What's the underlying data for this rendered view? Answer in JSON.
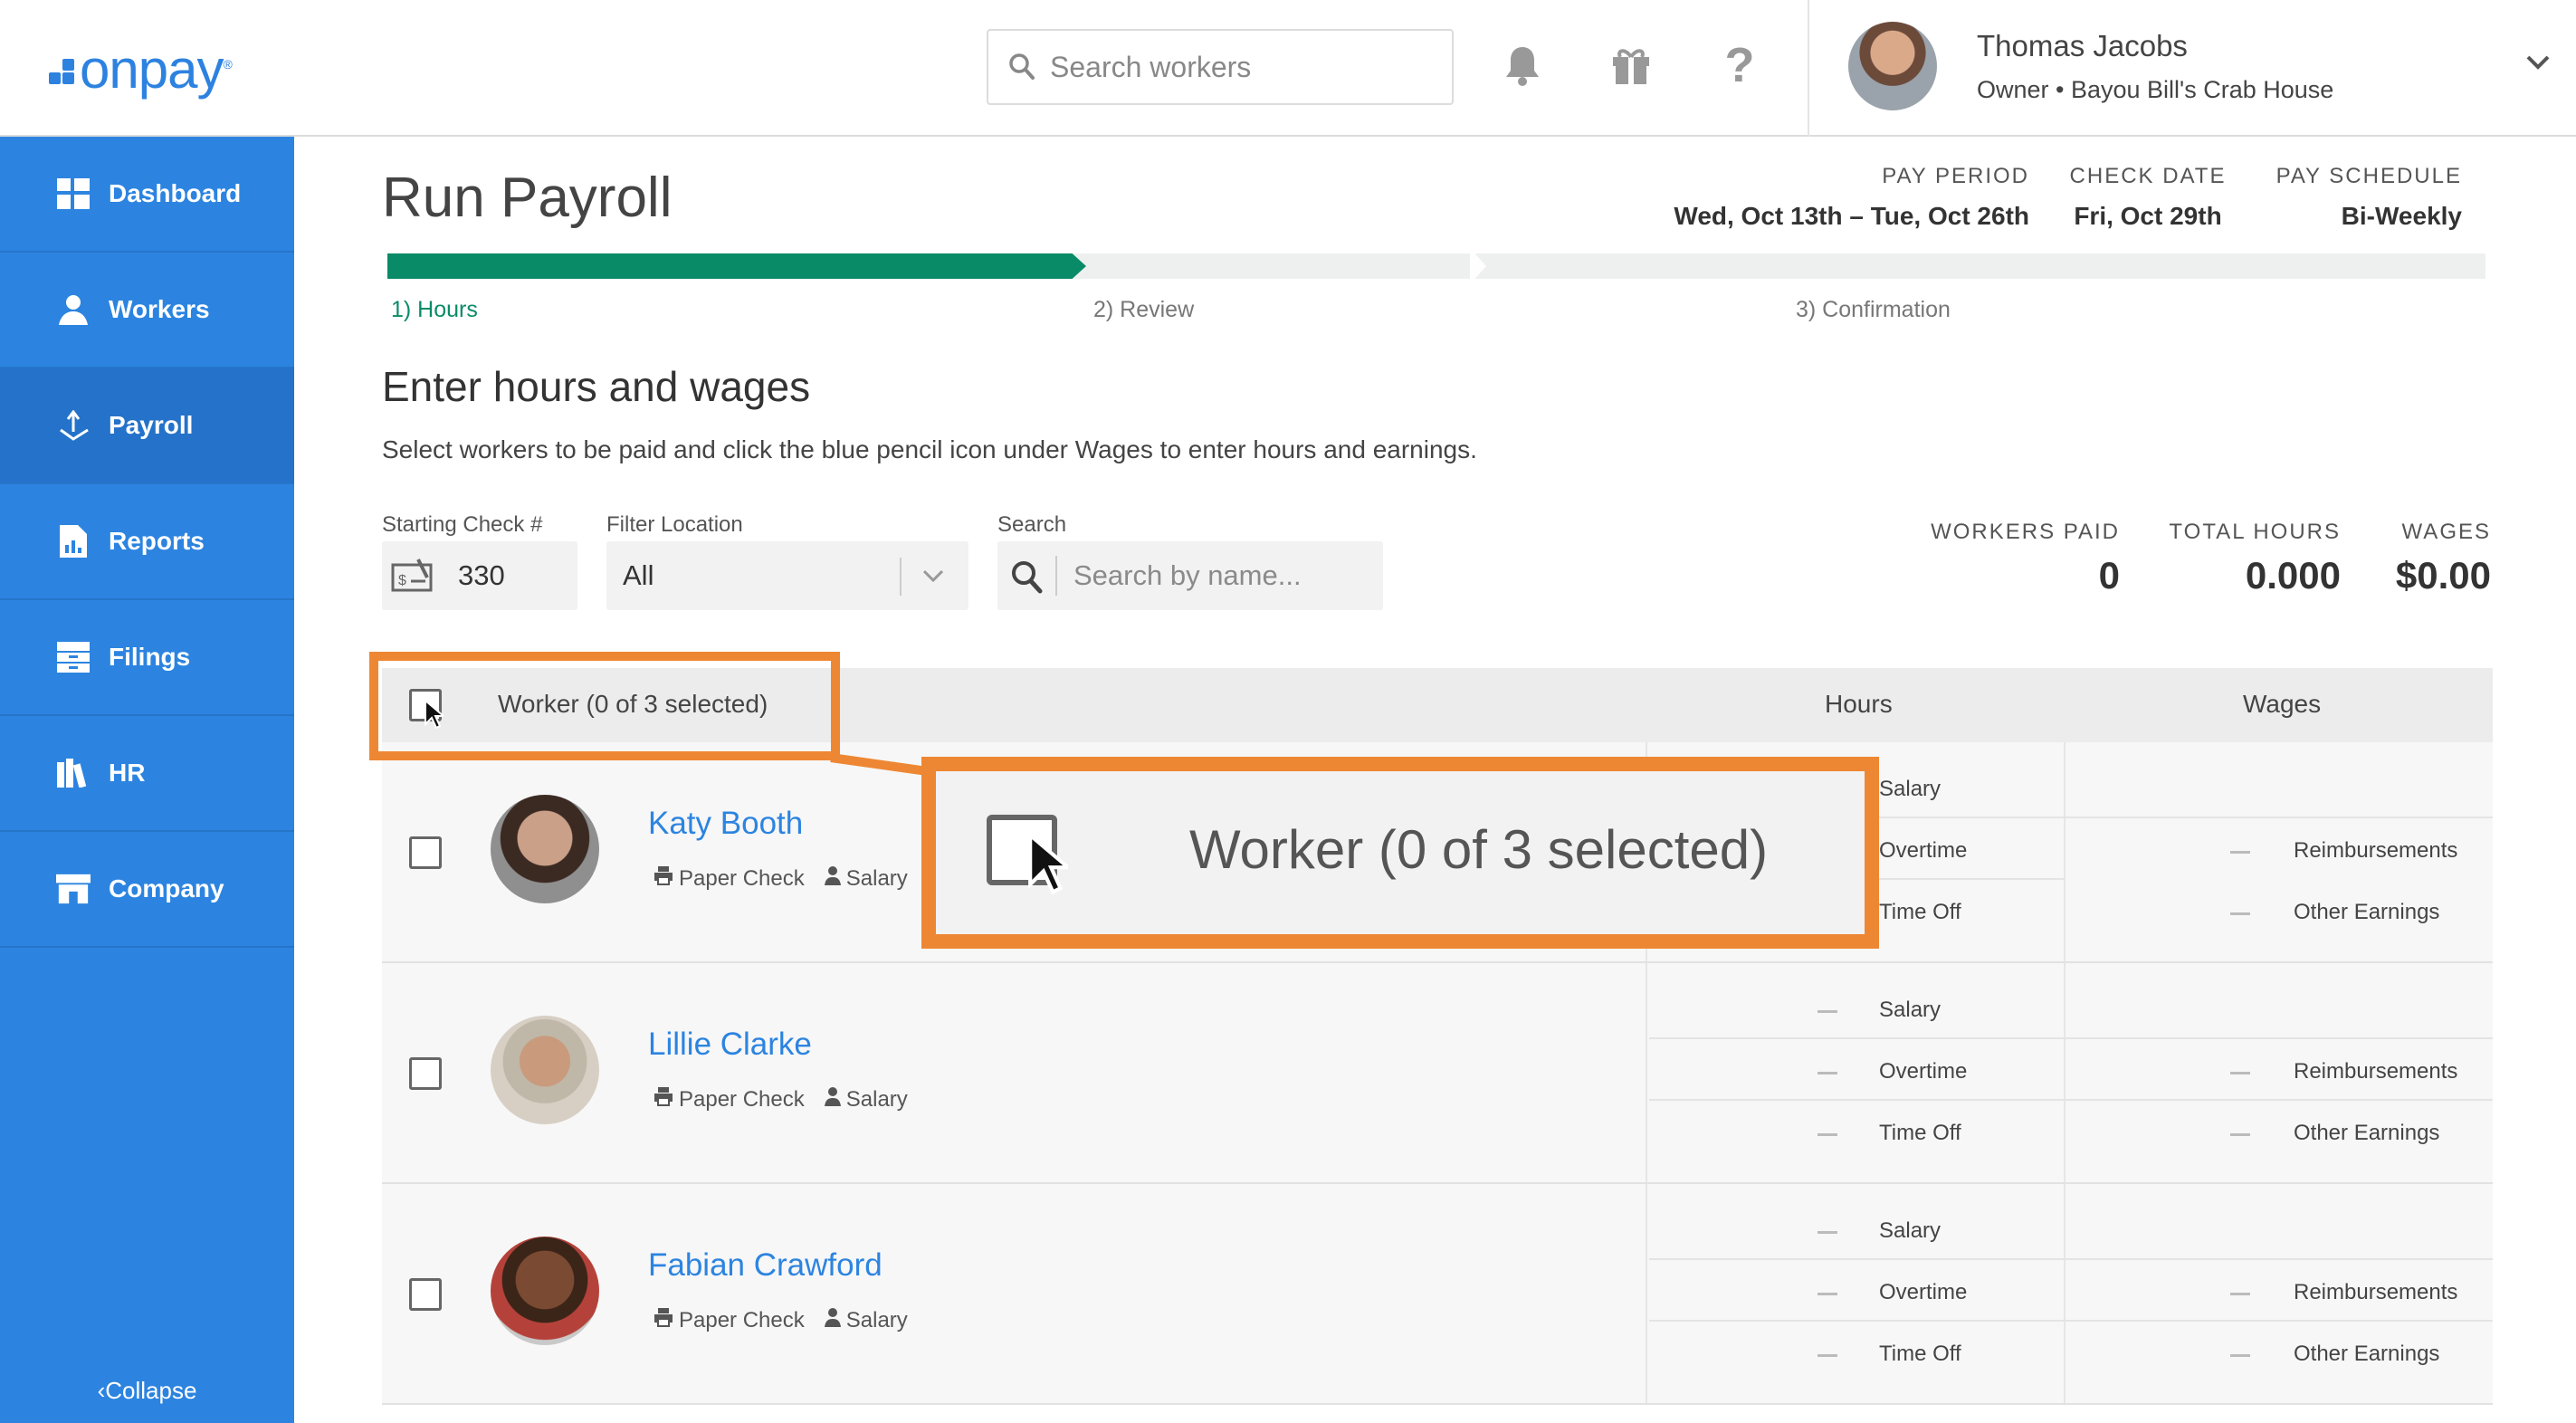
{
  "brand": {
    "logo_text": "onpay",
    "accent": "#2c84e0",
    "progress_color": "#0a8b67",
    "highlight_color": "#ee8733"
  },
  "header": {
    "search_placeholder": "Search workers",
    "icons": [
      "bell-icon",
      "gift-icon",
      "help-icon"
    ],
    "user_name": "Thomas Jacobs",
    "user_role": "Owner • Bayou Bill's Crab House"
  },
  "sidebar": {
    "items": [
      {
        "label": "Dashboard",
        "icon": "dashboard-icon"
      },
      {
        "label": "Workers",
        "icon": "workers-icon"
      },
      {
        "label": "Payroll",
        "icon": "payroll-icon",
        "active": true
      },
      {
        "label": "Reports",
        "icon": "reports-icon"
      },
      {
        "label": "Filings",
        "icon": "filings-icon"
      },
      {
        "label": "HR",
        "icon": "hr-icon"
      },
      {
        "label": "Company",
        "icon": "company-icon"
      }
    ],
    "collapse_label": "Collapse"
  },
  "page": {
    "title": "Run Payroll",
    "pay_period_label": "PAY PERIOD",
    "pay_period_value": "Wed, Oct 13th – Tue, Oct 26th",
    "check_date_label": "CHECK DATE",
    "check_date_value": "Fri, Oct 29th",
    "pay_schedule_label": "PAY SCHEDULE",
    "pay_schedule_value": "Bi-Weekly",
    "progress_fraction": 0.333,
    "steps": [
      "1) Hours",
      "2) Review",
      "3) Confirmation"
    ]
  },
  "section": {
    "title": "Enter hours and wages",
    "description": "Select workers to be paid and click the blue pencil icon under Wages to enter hours and earnings."
  },
  "filters": {
    "starting_check_label": "Starting Check #",
    "starting_check_value": "330",
    "location_label": "Filter Location",
    "location_value": "All",
    "search_label": "Search",
    "search_placeholder": "Search by name..."
  },
  "stats": {
    "workers_paid_label": "WORKERS PAID",
    "workers_paid_value": "0",
    "total_hours_label": "TOTAL HOURS",
    "total_hours_value": "0.000",
    "wages_label": "WAGES",
    "wages_value": "$0.00"
  },
  "table": {
    "worker_header": "Worker (0 of 3 selected)",
    "hours_header": "Hours",
    "wages_header": "Wages",
    "hours_lines": [
      "Salary",
      "Overtime",
      "Time Off"
    ],
    "wages_lines": [
      "Reimbursements",
      "Other Earnings"
    ],
    "rows": [
      {
        "name": "Katy Booth",
        "payment": "Paper Check",
        "type": "Salary"
      },
      {
        "name": "Lillie Clarke",
        "payment": "Paper Check",
        "type": "Salary"
      },
      {
        "name": "Fabian Crawford",
        "payment": "Paper Check",
        "type": "Salary"
      }
    ]
  },
  "callout": {
    "text": "Worker (0 of 3 selected)"
  }
}
